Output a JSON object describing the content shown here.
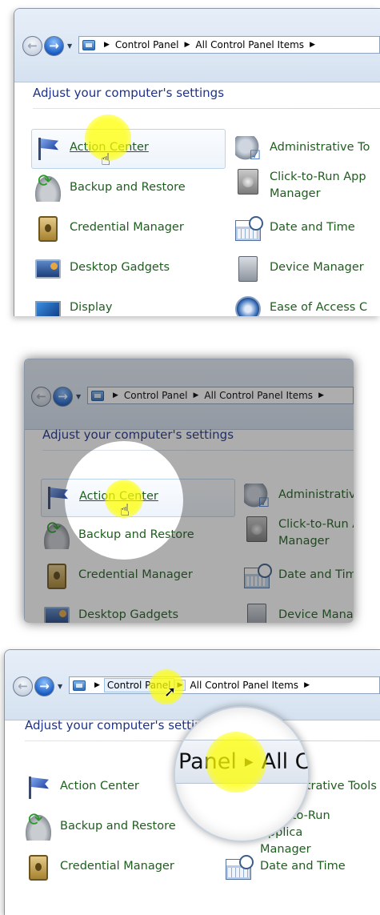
{
  "address": {
    "root": "Control Panel",
    "current": "All Control Panel Items"
  },
  "heading": "Adjust your computer's settings",
  "left_items": [
    {
      "label": "Action Center",
      "icon": "flag-icon"
    },
    {
      "label": "Backup and Restore",
      "icon": "backup-icon"
    },
    {
      "label": "Credential Manager",
      "icon": "vault-icon"
    },
    {
      "label": "Desktop Gadgets",
      "icon": "gadgets-icon"
    },
    {
      "label": "Display",
      "icon": "display-icon"
    }
  ],
  "right_items": [
    {
      "label": "Administrative Tools",
      "icon": "admin-tools-icon"
    },
    {
      "label": "Click-to-Run Application Manager",
      "icon": "click-to-run-icon"
    },
    {
      "label": "Date and Time",
      "icon": "calendar-clock-icon"
    },
    {
      "label": "Device Manager",
      "icon": "device-manager-icon"
    },
    {
      "label": "Ease of Access Center",
      "icon": "ease-of-access-icon"
    }
  ],
  "panel1": {
    "right": [
      "Administrative To",
      "Click-to-Run App",
      "Manager",
      "Date and Time",
      "Device Manager",
      "Ease of Access C"
    ]
  },
  "panel2": {
    "address_current": "All Control Panel Items",
    "right": [
      "Administrative",
      "Click-to-Run A",
      "Manager",
      "Date and Time",
      "Device Manag"
    ]
  },
  "panel3": {
    "heading_visible": "Adjust your computer's settin",
    "right": [
      "Administrative Tools",
      "Click-to-Run Applica",
      "Manager",
      "Date and Time"
    ],
    "mag_left": "Panel",
    "mag_right": "All Co"
  },
  "colors": {
    "link": "#1f5d1f",
    "heading": "#1e3287",
    "spotlight": "#ffff00"
  }
}
